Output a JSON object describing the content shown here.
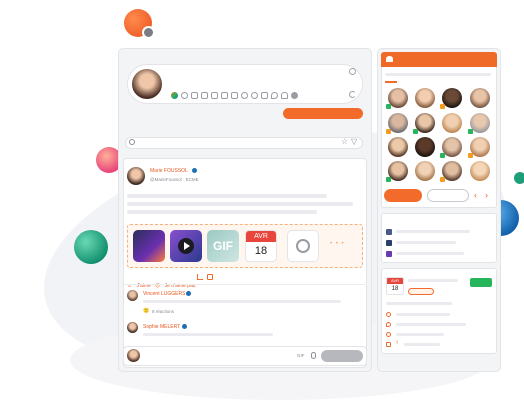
{
  "post": {
    "author": "Marie FOUSSOL",
    "handle": "@MarieFoussol · ECME"
  },
  "attachments": {
    "gif_label": "GIF",
    "calendar_month": "AVR",
    "calendar_day": "18",
    "more_label": "• • •"
  },
  "reactions": {
    "like_label": "J'aime",
    "dislike_label": "Je n'aime pas"
  },
  "comments": [
    {
      "author": "Vincent LUGGERS",
      "reactions_label": "8 réactions"
    },
    {
      "author": "Sophie MELERT"
    }
  ],
  "composer": {
    "gif_label": "GIF"
  },
  "event": {
    "calendar_month": "AVR",
    "calendar_day": "18"
  },
  "icons": [
    "search-icon",
    "star-icon",
    "filter-icon",
    "smiley-icon",
    "refresh-icon",
    "play-icon",
    "chart-icon",
    "chevron-left-icon",
    "chevron-right-icon",
    "attachment-icon"
  ],
  "colors": {
    "accent": "#f36b2b",
    "header_orange": "#ef6a26",
    "teal": "#1e9e7a",
    "blue": "#1c6fb5",
    "pink": "#e8457a",
    "green_button": "#27b55b"
  }
}
